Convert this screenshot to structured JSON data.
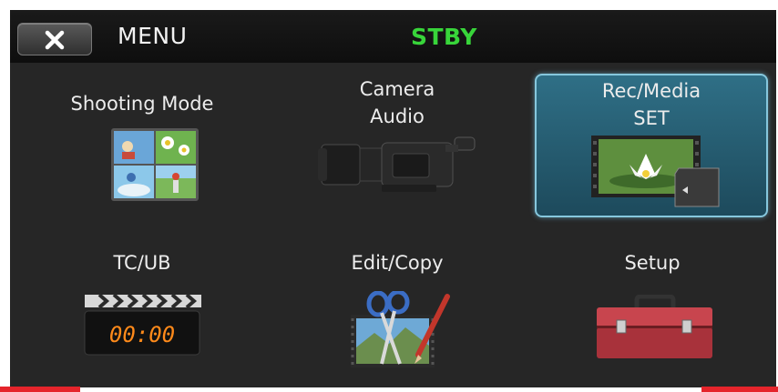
{
  "header": {
    "close_icon": "close-icon",
    "menu_title": "MENU",
    "status": "STBY",
    "status_color": "#38d53a"
  },
  "tiles": [
    {
      "label": "Shooting Mode",
      "icon": "shooting-mode-icon",
      "selected": false
    },
    {
      "label_line1": "Camera",
      "label_line2": "Audio",
      "icon": "camcorder-icon",
      "selected": false
    },
    {
      "label_line1": "Rec/Media",
      "label_line2": "SET",
      "icon": "memory-card-icon",
      "selected": true
    },
    {
      "label": "TC/UB",
      "icon": "clapperboard-icon",
      "timecode": "00:00",
      "selected": false
    },
    {
      "label": "Edit/Copy",
      "icon": "scissors-film-icon",
      "selected": false
    },
    {
      "label": "Setup",
      "icon": "toolbox-icon",
      "selected": false
    }
  ],
  "colors": {
    "selection": "#2f6f86",
    "accent_red": "#e5242b"
  }
}
